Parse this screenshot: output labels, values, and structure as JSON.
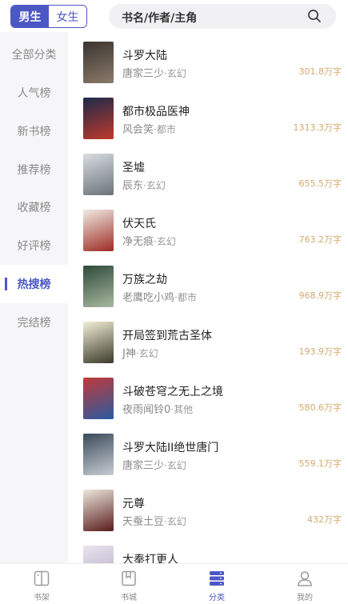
{
  "header": {
    "gender_tabs": [
      {
        "label": "男生",
        "active": true
      },
      {
        "label": "女生",
        "active": false
      }
    ],
    "search": {
      "placeholder": "书名/作者/主角",
      "icon": "search-icon"
    }
  },
  "sidebar": {
    "items": [
      {
        "label": "全部分类",
        "active": false
      },
      {
        "label": "人气榜",
        "active": false
      },
      {
        "label": "新书榜",
        "active": false
      },
      {
        "label": "推荐榜",
        "active": false
      },
      {
        "label": "收藏榜",
        "active": false
      },
      {
        "label": "好评榜",
        "active": false
      },
      {
        "label": "热搜榜",
        "active": true
      },
      {
        "label": "完结榜",
        "active": false
      }
    ]
  },
  "books": [
    {
      "title": "斗罗大陆",
      "author": "唐家三少",
      "sep": "·",
      "genre": "玄幻",
      "count": "301.8万字",
      "cover_colors": [
        "#3a3430",
        "#8a7a6a"
      ]
    },
    {
      "title": "都市极品医神",
      "author": "风会笑",
      "sep": "·",
      "genre": "都市",
      "count": "1313.3万字",
      "cover_colors": [
        "#1c2a4a",
        "#c0392b"
      ]
    },
    {
      "title": "圣墟",
      "author": "辰东",
      "sep": "·",
      "genre": "玄幻",
      "count": "655.5万字",
      "cover_colors": [
        "#d8dde0",
        "#6a737a"
      ]
    },
    {
      "title": "伏天氏",
      "author": "净无痕",
      "sep": "·",
      "genre": "玄幻",
      "count": "763.2万字",
      "cover_colors": [
        "#f0ebe4",
        "#9c2a22"
      ]
    },
    {
      "title": "万族之劫",
      "author": "老鹰吃小鸡",
      "sep": "·",
      "genre": "都市",
      "count": "968.9万字",
      "cover_colors": [
        "#2e4a3a",
        "#a9b8a0"
      ]
    },
    {
      "title": "开局签到荒古圣体",
      "author": "J神",
      "sep": "·",
      "genre": "玄幻",
      "count": "193.9万字",
      "cover_colors": [
        "#f3f0d8",
        "#3a3a2a"
      ]
    },
    {
      "title": "斗破苍穹之无上之境",
      "author": "夜雨闻铃0",
      "sep": "·",
      "genre": "其他",
      "count": "580.6万字",
      "cover_colors": [
        "#c03a3a",
        "#2a5aa0"
      ]
    },
    {
      "title": "斗罗大陆II绝世唐门",
      "author": "唐家三少",
      "sep": "·",
      "genre": "玄幻",
      "count": "559.1万字",
      "cover_colors": [
        "#3a4a5a",
        "#c8cdd4"
      ]
    },
    {
      "title": "元尊",
      "author": "天蚕土豆",
      "sep": "·",
      "genre": "玄幻",
      "count": "432万字",
      "cover_colors": [
        "#ece7de",
        "#5a1c1c"
      ]
    },
    {
      "title": "大奉打更人",
      "author": "",
      "sep": "",
      "genre": "",
      "count": "",
      "cover_colors": [
        "#e8e4ee",
        "#b0a8c4"
      ]
    }
  ],
  "bottom_nav": [
    {
      "label": "书架",
      "icon": "bookshelf-icon",
      "active": false
    },
    {
      "label": "书城",
      "icon": "bookstore-icon",
      "active": false
    },
    {
      "label": "分类",
      "icon": "category-icon",
      "active": true
    },
    {
      "label": "我的",
      "icon": "profile-icon",
      "active": false
    }
  ],
  "colors": {
    "accent": "#4b57c4",
    "word_count": "#d4a86a",
    "sidebar_bg": "#f6f6f8"
  }
}
